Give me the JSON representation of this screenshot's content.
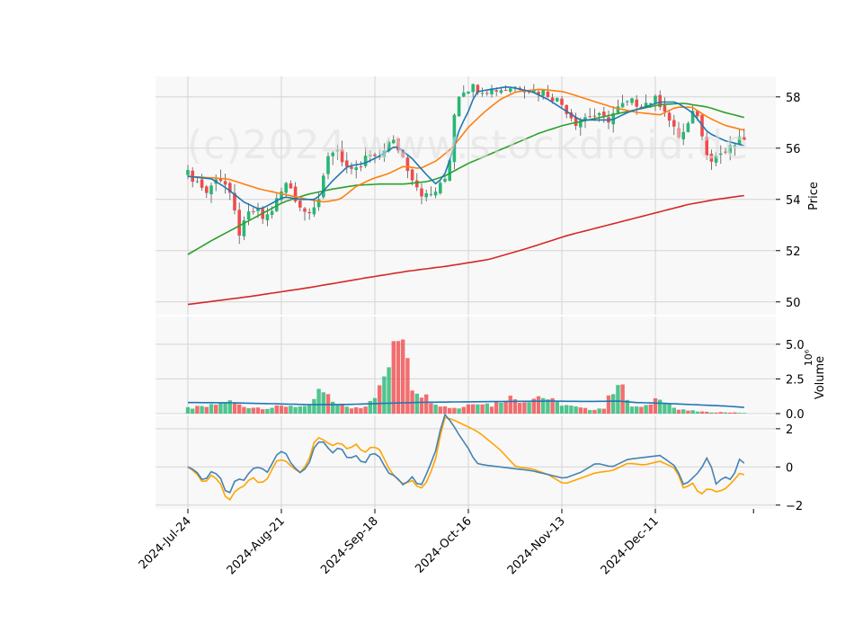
{
  "watermark": "(c)2024 www.stockdroid.de",
  "colors": {
    "panel_bg": "#f8f8f8",
    "grid": "#d4d4d4",
    "up": "#26b874",
    "down": "#f04b4b",
    "ma_short": "#1f77b4",
    "ma_mid": "#ff7f0e",
    "ma_long": "#2ca02c",
    "ma_200": "#d62728",
    "osc_a": "#4682b4",
    "osc_b": "#ffa500"
  },
  "chart_data": [
    {
      "type": "candlestick",
      "ylabel": "Price",
      "ylim": [
        49.5,
        58.8
      ],
      "yticks": [
        50,
        52,
        54,
        56,
        58
      ],
      "x_tick_labels": [
        "2024-Jul-24",
        "2024-Aug-21",
        "2024-Sep-18",
        "2024-Oct-16",
        "2024-Nov-13",
        "2024-Dec-11"
      ],
      "x_tick_index": [
        0,
        20,
        40,
        60,
        80,
        100
      ],
      "n_periods": 120,
      "price_anchors": [
        [
          0,
          55.0
        ],
        [
          3,
          54.6
        ],
        [
          5,
          54.2
        ],
        [
          7,
          54.9
        ],
        [
          9,
          54.7
        ],
        [
          11,
          53.9
        ],
        [
          13,
          52.6
        ],
        [
          15,
          53.4
        ],
        [
          17,
          53.6
        ],
        [
          19,
          53.2
        ],
        [
          21,
          53.6
        ],
        [
          23,
          54.2
        ],
        [
          25,
          54.7
        ],
        [
          27,
          54.0
        ],
        [
          29,
          53.5
        ],
        [
          31,
          53.7
        ],
        [
          33,
          54.1
        ],
        [
          35,
          55.6
        ],
        [
          37,
          56.1
        ],
        [
          39,
          55.4
        ],
        [
          41,
          55.0
        ],
        [
          43,
          55.2
        ],
        [
          45,
          55.8
        ],
        [
          47,
          55.5
        ],
        [
          49,
          56.0
        ],
        [
          51,
          56.3
        ],
        [
          53,
          55.9
        ],
        [
          55,
          55.2
        ],
        [
          57,
          54.6
        ],
        [
          59,
          54.1
        ],
        [
          61,
          54.2
        ],
        [
          63,
          54.5
        ],
        [
          65,
          55.0
        ],
        [
          67,
          58.0
        ],
        [
          69,
          58.3
        ],
        [
          71,
          58.4
        ],
        [
          73,
          58.3
        ],
        [
          75,
          58.3
        ],
        [
          77,
          58.3
        ],
        [
          79,
          58.3
        ],
        [
          81,
          58.4
        ],
        [
          83,
          58.4
        ],
        [
          85,
          58.3
        ],
        [
          87,
          58.2
        ],
        [
          89,
          58.2
        ],
        [
          91,
          58.0
        ],
        [
          93,
          57.8
        ],
        [
          95,
          57.4
        ],
        [
          97,
          57.0
        ],
        [
          99,
          57.2
        ],
        [
          101,
          57.3
        ],
        [
          103,
          57.2
        ],
        [
          105,
          57.1
        ],
        [
          107,
          57.5
        ],
        [
          109,
          57.7
        ],
        [
          111,
          57.8
        ],
        [
          113,
          57.7
        ],
        [
          115,
          57.8
        ],
        [
          117,
          57.9
        ],
        [
          119,
          57.6
        ],
        [
          121,
          56.8
        ],
        [
          123,
          56.4
        ],
        [
          125,
          56.9
        ],
        [
          127,
          57.6
        ],
        [
          129,
          56.0
        ],
        [
          131,
          55.6
        ],
        [
          133,
          55.8
        ],
        [
          135,
          55.9
        ],
        [
          137,
          56.2
        ],
        [
          139,
          56.4
        ]
      ],
      "ma_short_anchors": [
        [
          0,
          54.9
        ],
        [
          6,
          54.8
        ],
        [
          10,
          54.4
        ],
        [
          14,
          53.9
        ],
        [
          18,
          53.6
        ],
        [
          24,
          54.1
        ],
        [
          28,
          54.0
        ],
        [
          32,
          54.0
        ],
        [
          36,
          54.7
        ],
        [
          40,
          55.3
        ],
        [
          44,
          55.4
        ],
        [
          48,
          55.7
        ],
        [
          52,
          56.1
        ],
        [
          56,
          55.6
        ],
        [
          60,
          54.9
        ],
        [
          62,
          54.6
        ],
        [
          64,
          54.9
        ],
        [
          66,
          55.8
        ],
        [
          68,
          56.8
        ],
        [
          70,
          57.4
        ],
        [
          72,
          58.2
        ],
        [
          76,
          58.3
        ],
        [
          80,
          58.4
        ],
        [
          86,
          58.2
        ],
        [
          90,
          57.9
        ],
        [
          94,
          57.5
        ],
        [
          98,
          57.1
        ],
        [
          102,
          57.1
        ],
        [
          106,
          57.1
        ],
        [
          110,
          57.4
        ],
        [
          114,
          57.6
        ],
        [
          118,
          57.8
        ],
        [
          122,
          57.8
        ],
        [
          126,
          57.4
        ],
        [
          130,
          56.6
        ],
        [
          134,
          56.3
        ],
        [
          139,
          56.1
        ]
      ],
      "ma_mid_anchors": [
        [
          0,
          54.9
        ],
        [
          10,
          54.8
        ],
        [
          18,
          54.4
        ],
        [
          24,
          54.2
        ],
        [
          30,
          54.0
        ],
        [
          34,
          53.9
        ],
        [
          38,
          54.0
        ],
        [
          42,
          54.5
        ],
        [
          46,
          54.8
        ],
        [
          50,
          55.0
        ],
        [
          54,
          55.3
        ],
        [
          58,
          55.2
        ],
        [
          62,
          55.5
        ],
        [
          66,
          56.0
        ],
        [
          70,
          56.8
        ],
        [
          74,
          57.4
        ],
        [
          78,
          57.9
        ],
        [
          82,
          58.2
        ],
        [
          88,
          58.3
        ],
        [
          94,
          58.2
        ],
        [
          100,
          57.9
        ],
        [
          106,
          57.6
        ],
        [
          112,
          57.4
        ],
        [
          118,
          57.3
        ],
        [
          122,
          57.6
        ],
        [
          126,
          57.6
        ],
        [
          130,
          57.2
        ],
        [
          134,
          56.9
        ],
        [
          139,
          56.7
        ]
      ],
      "ma_long_anchors": [
        [
          0,
          51.85
        ],
        [
          6,
          52.4
        ],
        [
          12,
          52.9
        ],
        [
          18,
          53.4
        ],
        [
          24,
          53.9
        ],
        [
          30,
          54.2
        ],
        [
          36,
          54.4
        ],
        [
          42,
          54.55
        ],
        [
          48,
          54.6
        ],
        [
          54,
          54.6
        ],
        [
          60,
          54.7
        ],
        [
          64,
          54.9
        ],
        [
          70,
          55.4
        ],
        [
          76,
          55.8
        ],
        [
          82,
          56.2
        ],
        [
          88,
          56.6
        ],
        [
          94,
          56.9
        ],
        [
          100,
          57.1
        ],
        [
          106,
          57.3
        ],
        [
          112,
          57.5
        ],
        [
          118,
          57.7
        ],
        [
          124,
          57.75
        ],
        [
          130,
          57.6
        ],
        [
          134,
          57.4
        ],
        [
          139,
          57.2
        ]
      ],
      "ma_200_anchors": [
        [
          0,
          49.9
        ],
        [
          15,
          50.2
        ],
        [
          30,
          50.55
        ],
        [
          45,
          50.95
        ],
        [
          55,
          51.2
        ],
        [
          65,
          51.4
        ],
        [
          75,
          51.65
        ],
        [
          85,
          52.1
        ],
        [
          95,
          52.6
        ],
        [
          105,
          53.0
        ],
        [
          115,
          53.4
        ],
        [
          125,
          53.8
        ],
        [
          132,
          54.0
        ],
        [
          139,
          54.15
        ]
      ]
    },
    {
      "type": "bar",
      "ylabel": "Volume",
      "yunit": "10^6",
      "ylim": [
        0,
        7.0
      ],
      "yticks": [
        0.0,
        2.5,
        5.0
      ],
      "ytick_labels": [
        "0.0",
        "2.5",
        "5.0"
      ],
      "volume_anchors": [
        [
          0,
          0.4
        ],
        [
          5,
          0.5
        ],
        [
          10,
          0.9
        ],
        [
          14,
          0.5
        ],
        [
          20,
          0.4
        ],
        [
          26,
          0.6
        ],
        [
          30,
          0.4
        ],
        [
          33,
          1.7
        ],
        [
          36,
          0.9
        ],
        [
          40,
          0.4
        ],
        [
          44,
          0.5
        ],
        [
          48,
          1.8
        ],
        [
          54,
          6.4
        ],
        [
          56,
          2.0
        ],
        [
          60,
          1.1
        ],
        [
          64,
          0.5
        ],
        [
          68,
          0.4
        ],
        [
          72,
          0.9
        ],
        [
          76,
          0.6
        ],
        [
          80,
          1.2
        ],
        [
          84,
          0.9
        ],
        [
          88,
          1.3
        ],
        [
          92,
          0.8
        ],
        [
          96,
          0.5
        ],
        [
          100,
          0.3
        ],
        [
          104,
          0.4
        ],
        [
          108,
          2.8
        ],
        [
          110,
          0.6
        ],
        [
          114,
          0.4
        ],
        [
          118,
          1.3
        ],
        [
          122,
          0.3
        ],
        [
          126,
          0.2
        ],
        [
          130,
          0.1
        ],
        [
          134,
          0.1
        ],
        [
          139,
          0.05
        ]
      ],
      "volume_ma_anchors": [
        [
          0,
          0.8
        ],
        [
          10,
          0.78
        ],
        [
          20,
          0.72
        ],
        [
          30,
          0.65
        ],
        [
          40,
          0.66
        ],
        [
          50,
          0.75
        ],
        [
          60,
          0.82
        ],
        [
          70,
          0.85
        ],
        [
          80,
          0.88
        ],
        [
          90,
          0.9
        ],
        [
          100,
          0.88
        ],
        [
          108,
          0.9
        ],
        [
          112,
          0.8
        ],
        [
          118,
          0.75
        ],
        [
          126,
          0.65
        ],
        [
          134,
          0.55
        ],
        [
          139,
          0.45
        ]
      ]
    },
    {
      "type": "line",
      "ylim": [
        -2.2,
        2.7
      ],
      "yticks": [
        -2,
        0,
        2
      ],
      "osc_a_anchors": [
        [
          0,
          0.0
        ],
        [
          2,
          -0.2
        ],
        [
          4,
          -0.8
        ],
        [
          6,
          -0.2
        ],
        [
          8,
          -0.5
        ],
        [
          10,
          -1.6
        ],
        [
          12,
          -0.6
        ],
        [
          14,
          -0.7
        ],
        [
          16,
          -0.1
        ],
        [
          18,
          0.0
        ],
        [
          20,
          -0.3
        ],
        [
          22,
          0.6
        ],
        [
          24,
          0.9
        ],
        [
          26,
          0.1
        ],
        [
          28,
          -0.3
        ],
        [
          30,
          0.0
        ],
        [
          32,
          1.3
        ],
        [
          34,
          1.3
        ],
        [
          36,
          0.7
        ],
        [
          38,
          1.1
        ],
        [
          40,
          0.4
        ],
        [
          42,
          0.6
        ],
        [
          44,
          0.1
        ],
        [
          46,
          0.8
        ],
        [
          48,
          0.5
        ],
        [
          50,
          -0.3
        ],
        [
          52,
          -0.5
        ],
        [
          54,
          -1.0
        ],
        [
          56,
          -0.5
        ],
        [
          58,
          -1.1
        ],
        [
          60,
          -0.2
        ],
        [
          62,
          0.9
        ],
        [
          64,
          2.8
        ],
        [
          66,
          2.3
        ],
        [
          68,
          1.6
        ],
        [
          70,
          1.0
        ],
        [
          72,
          0.2
        ],
        [
          74,
          0.1
        ],
        [
          78,
          0.0
        ],
        [
          82,
          -0.1
        ],
        [
          86,
          -0.2
        ],
        [
          90,
          -0.4
        ],
        [
          94,
          -0.6
        ],
        [
          98,
          -0.3
        ],
        [
          102,
          0.2
        ],
        [
          106,
          0.0
        ],
        [
          110,
          0.4
        ],
        [
          114,
          0.5
        ],
        [
          118,
          0.6
        ],
        [
          122,
          0.0
        ],
        [
          124,
          -1.0
        ],
        [
          126,
          -0.6
        ],
        [
          128,
          -0.2
        ],
        [
          130,
          0.6
        ],
        [
          132,
          -0.9
        ],
        [
          134,
          -0.5
        ],
        [
          136,
          -0.7
        ],
        [
          138,
          0.5
        ],
        [
          139,
          0.2
        ]
      ],
      "osc_b_anchors": [
        [
          0,
          0.0
        ],
        [
          2,
          -0.3
        ],
        [
          4,
          -0.9
        ],
        [
          6,
          -0.4
        ],
        [
          8,
          -0.8
        ],
        [
          10,
          -1.9
        ],
        [
          12,
          -1.2
        ],
        [
          14,
          -1.0
        ],
        [
          16,
          -0.5
        ],
        [
          18,
          -0.9
        ],
        [
          20,
          -0.6
        ],
        [
          22,
          0.3
        ],
        [
          24,
          0.4
        ],
        [
          26,
          0.0
        ],
        [
          28,
          -0.3
        ],
        [
          30,
          0.2
        ],
        [
          32,
          1.6
        ],
        [
          34,
          1.4
        ],
        [
          36,
          1.1
        ],
        [
          38,
          1.3
        ],
        [
          40,
          0.9
        ],
        [
          42,
          1.2
        ],
        [
          44,
          0.7
        ],
        [
          46,
          1.1
        ],
        [
          48,
          0.9
        ],
        [
          50,
          0.0
        ],
        [
          52,
          -0.6
        ],
        [
          54,
          -0.9
        ],
        [
          56,
          -0.7
        ],
        [
          58,
          -1.2
        ],
        [
          60,
          -0.7
        ],
        [
          62,
          0.5
        ],
        [
          64,
          2.6
        ],
        [
          66,
          2.5
        ],
        [
          68,
          2.3
        ],
        [
          70,
          2.1
        ],
        [
          72,
          1.9
        ],
        [
          74,
          1.6
        ],
        [
          78,
          0.9
        ],
        [
          82,
          0.0
        ],
        [
          86,
          -0.1
        ],
        [
          90,
          -0.4
        ],
        [
          94,
          -0.9
        ],
        [
          98,
          -0.6
        ],
        [
          102,
          -0.3
        ],
        [
          106,
          -0.2
        ],
        [
          110,
          0.2
        ],
        [
          114,
          0.1
        ],
        [
          118,
          0.3
        ],
        [
          122,
          -0.1
        ],
        [
          124,
          -1.2
        ],
        [
          126,
          -0.8
        ],
        [
          128,
          -1.5
        ],
        [
          130,
          -1.1
        ],
        [
          132,
          -1.3
        ],
        [
          134,
          -1.2
        ],
        [
          136,
          -0.8
        ],
        [
          138,
          -0.3
        ],
        [
          139,
          -0.4
        ]
      ]
    }
  ]
}
